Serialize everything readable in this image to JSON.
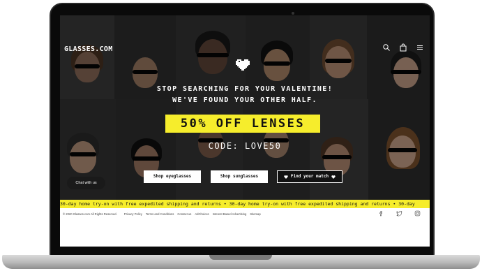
{
  "header": {
    "brand": "GLASSES.COM",
    "icons": [
      "search-icon",
      "bag-icon",
      "menu-icon"
    ]
  },
  "hero": {
    "headline_line1": "STOP SEARCHING FOR YOUR VALENTINE!",
    "headline_line2": "WE'VE FOUND YOUR OTHER HALF.",
    "offer": "50% OFF LENSES",
    "code": "CODE: LOVE50",
    "buttons": {
      "eyeglasses": "Shop eyeglasses",
      "sunglasses": "Shop sunglasses",
      "match": "Find your match"
    },
    "chat_label": "Chat with us"
  },
  "ticker": {
    "text": "30-day home try-on with free expedited shipping and returns • 30-day home try-on with free expedited shipping and returns • 30-day"
  },
  "footer": {
    "copyright": "© 2020 Glasses.com All Rights Reserved.",
    "links": [
      "Privacy Policy",
      "Terms and Conditions",
      "Contact us",
      "AdChoices",
      "Interest Based Advertising",
      "Sitemap"
    ],
    "social": [
      "facebook-icon",
      "twitter-icon",
      "instagram-icon"
    ]
  },
  "colors": {
    "accent_yellow": "#f6ed2c",
    "hero_dark": "#1c1c1c",
    "text_white": "#ffffff"
  }
}
